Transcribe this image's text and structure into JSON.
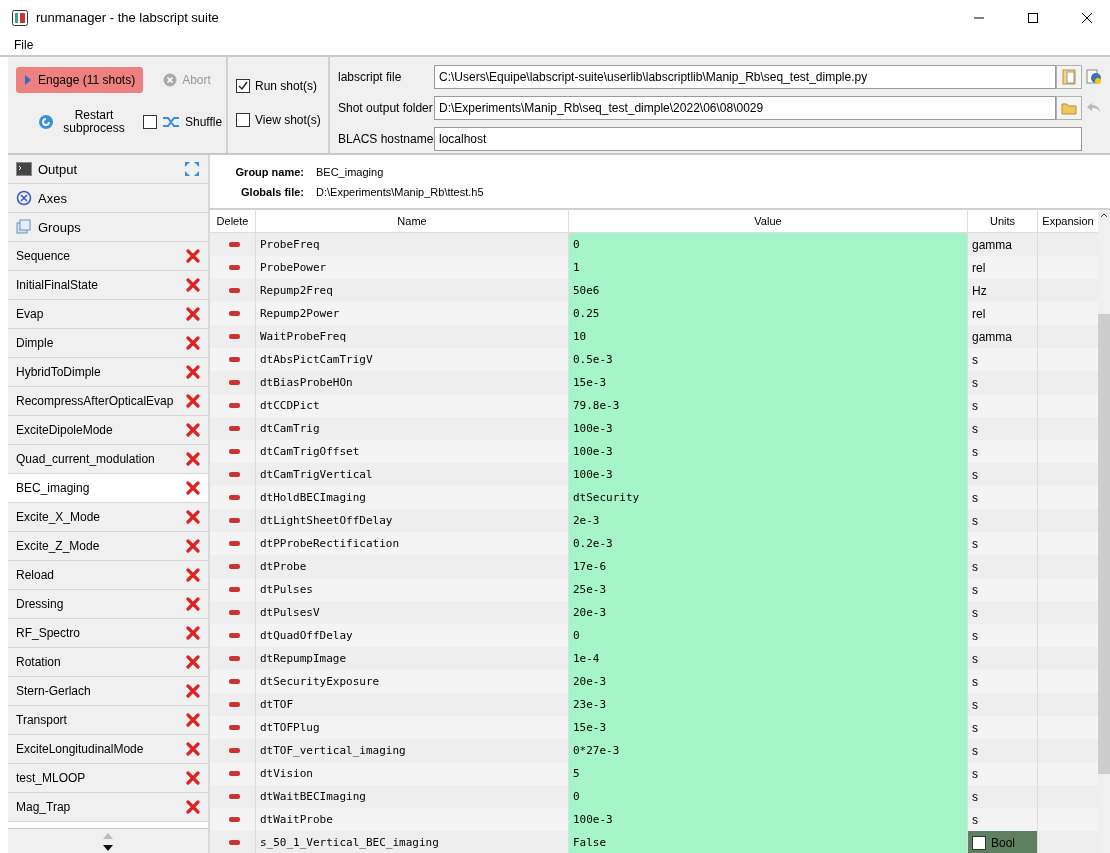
{
  "window": {
    "title": "runmanager - the labscript suite"
  },
  "menu": [
    "File"
  ],
  "toolbar": {
    "engage": "Engage (11 shots)",
    "abort": "Abort",
    "restart": "Restart subprocess",
    "shuffle": {
      "label": "Shuffle",
      "checked": false
    },
    "run_shots": {
      "label": "Run shot(s)",
      "checked": true
    },
    "view_shots": {
      "label": "View shot(s)",
      "checked": false
    },
    "fields": [
      {
        "label": "labscript file",
        "value": "C:\\Users\\Equipe\\labscript-suite\\userlib\\labscriptlib\\Manip_Rb\\seq_test_dimple.py",
        "kind": "file"
      },
      {
        "label": "Shot output folder",
        "value": "D:\\Experiments\\Manip_Rb\\seq_test_dimple\\2022\\06\\08\\0029",
        "kind": "folder"
      },
      {
        "label": "BLACS hostname",
        "value": "localhost",
        "kind": "plain"
      }
    ]
  },
  "sidebar": {
    "items": [
      {
        "label": "Output",
        "kind": "output",
        "selected": false
      },
      {
        "label": "Axes",
        "kind": "axes",
        "selected": false
      },
      {
        "label": "Groups",
        "kind": "groups",
        "selected": false
      },
      {
        "label": "Sequence",
        "kind": "group",
        "selected": false
      },
      {
        "label": "InitialFinalState",
        "kind": "group",
        "selected": false
      },
      {
        "label": "Evap",
        "kind": "group",
        "selected": false
      },
      {
        "label": "Dimple",
        "kind": "group",
        "selected": false
      },
      {
        "label": "HybridToDimple",
        "kind": "group",
        "selected": false
      },
      {
        "label": "RecompressAfterOpticalEvap",
        "kind": "group",
        "selected": false
      },
      {
        "label": "ExciteDipoleMode",
        "kind": "group",
        "selected": false
      },
      {
        "label": "Quad_current_modulation",
        "kind": "group",
        "selected": false
      },
      {
        "label": "BEC_imaging",
        "kind": "group",
        "selected": true
      },
      {
        "label": "Excite_X_Mode",
        "kind": "group",
        "selected": false
      },
      {
        "label": "Excite_Z_Mode",
        "kind": "group",
        "selected": false
      },
      {
        "label": "Reload",
        "kind": "group",
        "selected": false
      },
      {
        "label": "Dressing",
        "kind": "group",
        "selected": false
      },
      {
        "label": "RF_Spectro",
        "kind": "group",
        "selected": false
      },
      {
        "label": "Rotation",
        "kind": "group",
        "selected": false
      },
      {
        "label": "Stern-Gerlach",
        "kind": "group",
        "selected": false
      },
      {
        "label": "Transport",
        "kind": "group",
        "selected": false
      },
      {
        "label": "ExciteLongitudinalMode",
        "kind": "group",
        "selected": false
      },
      {
        "label": "test_MLOOP",
        "kind": "group",
        "selected": false
      },
      {
        "label": "Mag_Trap",
        "kind": "group",
        "selected": false
      }
    ]
  },
  "group": {
    "name_label": "Group name:",
    "name": "BEC_imaging",
    "file_label": "Globals file:",
    "file": "D:\\Experiments\\Manip_Rb\\ttest.h5"
  },
  "table": {
    "columns": [
      "Delete",
      "Name",
      "Value",
      "Units",
      "Expansion"
    ],
    "rows": [
      {
        "name": "ProbeFreq",
        "value": "0",
        "units": "gamma"
      },
      {
        "name": "ProbePower",
        "value": "1",
        "units": "rel"
      },
      {
        "name": "Repump2Freq",
        "value": "50e6",
        "units": "Hz"
      },
      {
        "name": "Repump2Power",
        "value": "0.25",
        "units": "rel"
      },
      {
        "name": "WaitProbeFreq",
        "value": "10",
        "units": "gamma"
      },
      {
        "name": "dtAbsPictCamTrigV",
        "value": "0.5e-3",
        "units": "s"
      },
      {
        "name": "dtBiasProbeHOn",
        "value": "15e-3",
        "units": "s"
      },
      {
        "name": "dtCCDPict",
        "value": "79.8e-3",
        "units": "s"
      },
      {
        "name": "dtCamTrig",
        "value": "100e-3",
        "units": "s"
      },
      {
        "name": "dtCamTrigOffset",
        "value": "100e-3",
        "units": "s"
      },
      {
        "name": "dtCamTrigVertical",
        "value": "100e-3",
        "units": "s"
      },
      {
        "name": "dtHoldBECImaging",
        "value": "dtSecurity",
        "units": "s"
      },
      {
        "name": "dtLightSheetOffDelay",
        "value": "2e-3",
        "units": "s"
      },
      {
        "name": "dtPProbeRectification",
        "value": "0.2e-3",
        "units": "s"
      },
      {
        "name": "dtProbe",
        "value": "17e-6",
        "units": "s"
      },
      {
        "name": "dtPulses",
        "value": "25e-3",
        "units": "s"
      },
      {
        "name": "dtPulsesV",
        "value": "20e-3",
        "units": "s"
      },
      {
        "name": "dtQuadOffDelay",
        "value": "0",
        "units": "s"
      },
      {
        "name": "dtRepumpImage",
        "value": "1e-4",
        "units": "s"
      },
      {
        "name": "dtSecurityExposure",
        "value": "20e-3",
        "units": "s"
      },
      {
        "name": "dtTOF",
        "value": "23e-3",
        "units": "s"
      },
      {
        "name": "dtTOFPlug",
        "value": "15e-3",
        "units": "s"
      },
      {
        "name": "dtTOF_vertical_imaging",
        "value": "0*27e-3",
        "units": "s"
      },
      {
        "name": "dtVision",
        "value": "5",
        "units": "s"
      },
      {
        "name": "dtWaitBECImaging",
        "value": "0",
        "units": "s"
      },
      {
        "name": "dtWaitProbe",
        "value": "100e-3",
        "units": "s"
      },
      {
        "name": "s_50_1_Vertical_BEC_imaging",
        "value": "False",
        "units": "Bool",
        "kind": "bool",
        "checked": false
      }
    ]
  }
}
